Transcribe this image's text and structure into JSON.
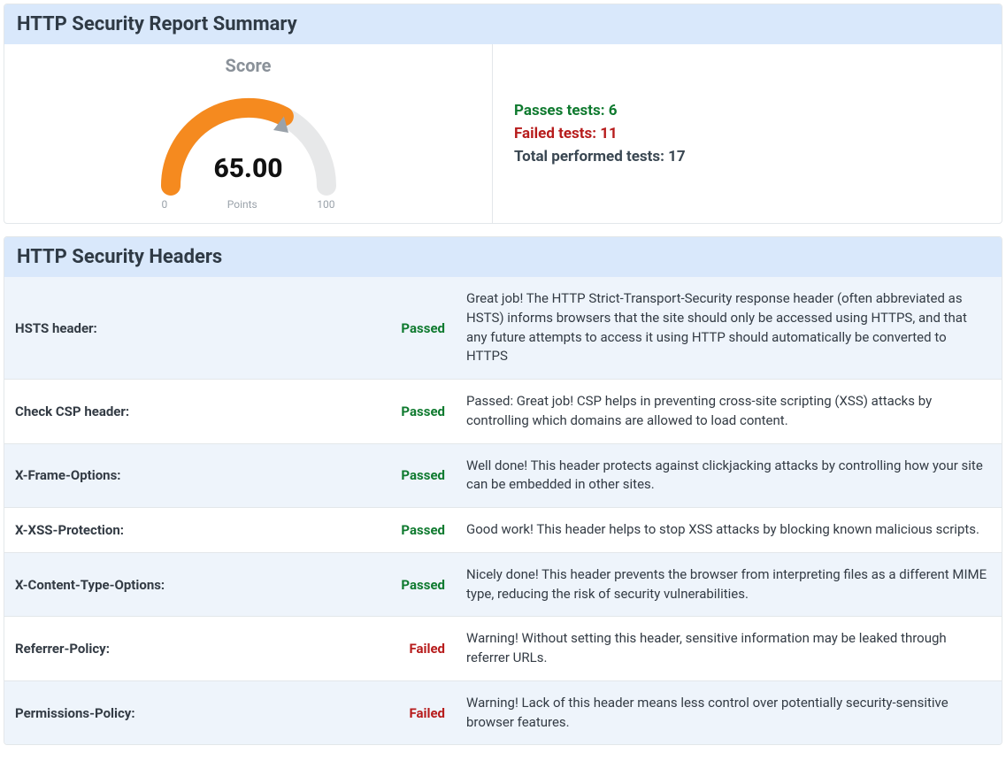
{
  "summary": {
    "title": "HTTP Security Report Summary",
    "score_label": "Score",
    "score_value": "65.00",
    "points_label": "Points",
    "min_label": "0",
    "max_label": "100",
    "passes_label": "Passes tests: 6",
    "failed_label": "Failed tests: 11",
    "total_label": "Total performed tests: 17"
  },
  "headers_section": {
    "title": "HTTP Security Headers"
  },
  "status": {
    "passed": "Passed",
    "failed": "Failed"
  },
  "headers": [
    {
      "name": "HSTS header:",
      "status": "passed",
      "desc": "Great job! The HTTP Strict-Transport-Security response header (often abbreviated as HSTS) informs browsers that the site should only be accessed using HTTPS, and that any future attempts to access it using HTTP should automatically be converted to HTTPS"
    },
    {
      "name": "Check CSP header:",
      "status": "passed",
      "desc": "Passed: Great job! CSP helps in preventing cross-site scripting (XSS) attacks by controlling which domains are allowed to load content."
    },
    {
      "name": "X-Frame-Options:",
      "status": "passed",
      "desc": "Well done! This header protects against clickjacking attacks by controlling how your site can be embedded in other sites."
    },
    {
      "name": "X-XSS-Protection:",
      "status": "passed",
      "desc": "Good work! This header helps to stop XSS attacks by blocking known malicious scripts."
    },
    {
      "name": "X-Content-Type-Options:",
      "status": "passed",
      "desc": "Nicely done! This header prevents the browser from interpreting files as a different MIME type, reducing the risk of security vulnerabilities."
    },
    {
      "name": "Referrer-Policy:",
      "status": "failed",
      "desc": "Warning! Without setting this header, sensitive information may be leaked through referrer URLs."
    },
    {
      "name": "Permissions-Policy:",
      "status": "failed",
      "desc": "Warning! Lack of this header means less control over potentially security-sensitive browser features."
    }
  ],
  "chart_data": {
    "type": "gauge",
    "value": 65.0,
    "min": 0,
    "max": 100,
    "title": "Score",
    "unit": "Points",
    "color_fill": "#f58a1f",
    "color_track": "#e7e8e9"
  }
}
